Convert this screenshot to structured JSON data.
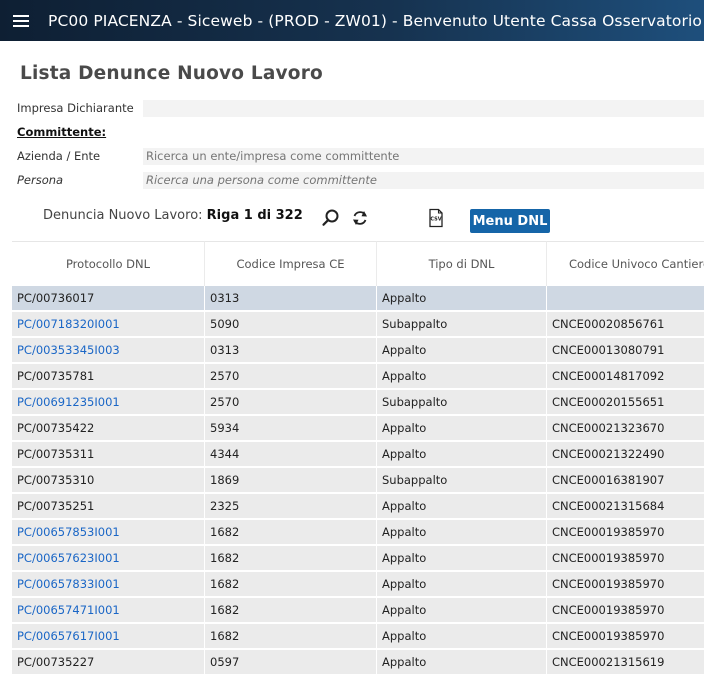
{
  "header": {
    "title": "PC00 PIACENZA - Siceweb - (PROD - ZW01) - Benvenuto Utente Cassa Osservatorio",
    "menu_icon": "hamburger-menu-icon"
  },
  "page": {
    "title": "Lista Denunce Nuovo Lavoro"
  },
  "form": {
    "impresa_label": "Impresa Dichiarante",
    "impresa_value": "",
    "committente_label": "Committente:",
    "azienda_label": "Azienda / Ente",
    "azienda_placeholder": "Ricerca un ente/impresa come committente",
    "persona_label": "Persona",
    "persona_placeholder": "Ricerca una persona come committente"
  },
  "toolbar": {
    "entity_label": "Denuncia Nuovo Lavoro:",
    "row_info": "Riga 1 di 322",
    "search_icon": "search-icon",
    "refresh_icon": "refresh-icon",
    "csv_icon": "csv-export-icon",
    "csv_text": "CSV",
    "menu_button": "Menu DNL"
  },
  "colors": {
    "accent": "#1565a8",
    "link": "#1a66c6",
    "selected_row": "#cfd8e3"
  },
  "table": {
    "columns": [
      "Protocollo DNL",
      "Codice Impresa CE",
      "Tipo di DNL",
      "Codice Univoco Cantiere"
    ],
    "rows": [
      {
        "protocollo": "PC/00736017",
        "link": false,
        "codice": "0313",
        "tipo": "Appalto",
        "cantiere": "",
        "selected": true
      },
      {
        "protocollo": "PC/00718320I001",
        "link": true,
        "codice": "5090",
        "tipo": "Subappalto",
        "cantiere": "CNCE00020856761"
      },
      {
        "protocollo": "PC/00353345I003",
        "link": true,
        "codice": "0313",
        "tipo": "Appalto",
        "cantiere": "CNCE00013080791"
      },
      {
        "protocollo": "PC/00735781",
        "link": false,
        "codice": "2570",
        "tipo": "Appalto",
        "cantiere": "CNCE00014817092"
      },
      {
        "protocollo": "PC/00691235I001",
        "link": true,
        "codice": "2570",
        "tipo": "Subappalto",
        "cantiere": "CNCE00020155651"
      },
      {
        "protocollo": "PC/00735422",
        "link": false,
        "codice": "5934",
        "tipo": "Appalto",
        "cantiere": "CNCE00021323670"
      },
      {
        "protocollo": "PC/00735311",
        "link": false,
        "codice": "4344",
        "tipo": "Appalto",
        "cantiere": "CNCE00021322490"
      },
      {
        "protocollo": "PC/00735310",
        "link": false,
        "codice": "1869",
        "tipo": "Subappalto",
        "cantiere": "CNCE00016381907"
      },
      {
        "protocollo": "PC/00735251",
        "link": false,
        "codice": "2325",
        "tipo": "Appalto",
        "cantiere": "CNCE00021315684"
      },
      {
        "protocollo": "PC/00657853I001",
        "link": true,
        "codice": "1682",
        "tipo": "Appalto",
        "cantiere": "CNCE00019385970"
      },
      {
        "protocollo": "PC/00657623I001",
        "link": true,
        "codice": "1682",
        "tipo": "Appalto",
        "cantiere": "CNCE00019385970"
      },
      {
        "protocollo": "PC/00657833I001",
        "link": true,
        "codice": "1682",
        "tipo": "Appalto",
        "cantiere": "CNCE00019385970"
      },
      {
        "protocollo": "PC/00657471I001",
        "link": true,
        "codice": "1682",
        "tipo": "Appalto",
        "cantiere": "CNCE00019385970"
      },
      {
        "protocollo": "PC/00657617I001",
        "link": true,
        "codice": "1682",
        "tipo": "Appalto",
        "cantiere": "CNCE00019385970"
      },
      {
        "protocollo": "PC/00735227",
        "link": false,
        "codice": "0597",
        "tipo": "Appalto",
        "cantiere": "CNCE00021315619"
      }
    ]
  }
}
